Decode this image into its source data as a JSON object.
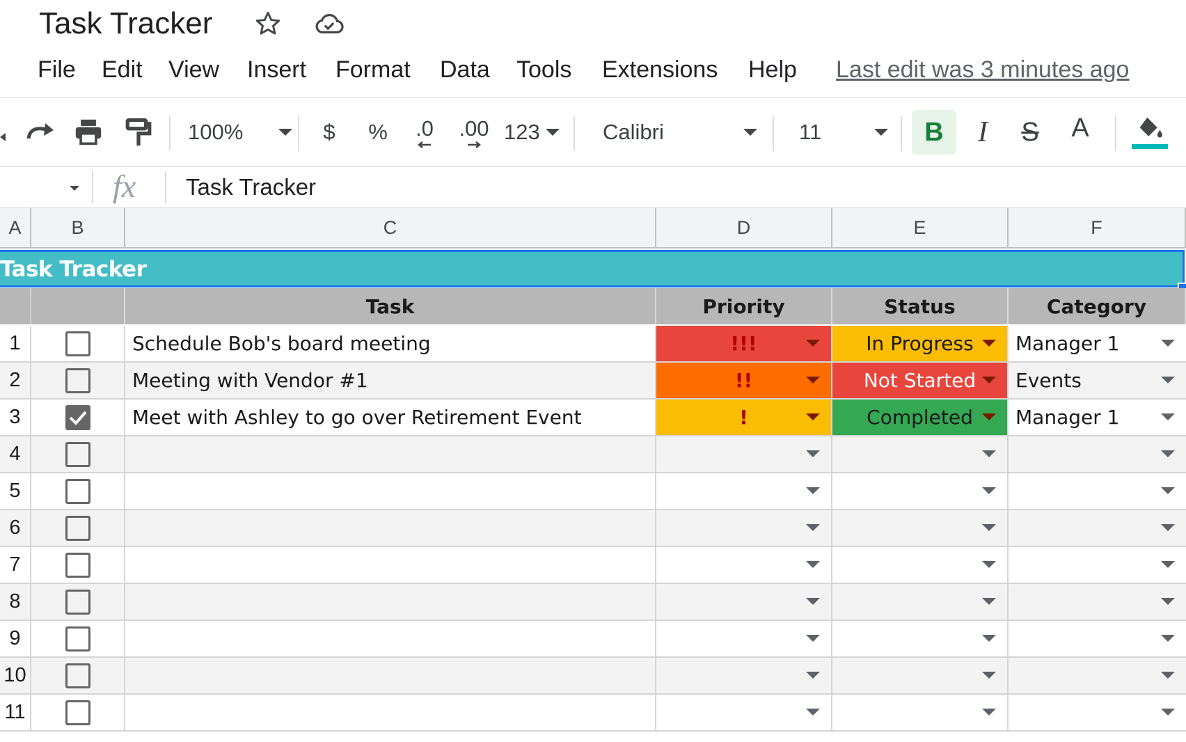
{
  "title": {
    "doc_name": "Task Tracker",
    "star_icon": "star-icon",
    "cloud_icon": "cloud-saved-icon"
  },
  "menu": {
    "items": [
      {
        "label": "File"
      },
      {
        "label": "Edit"
      },
      {
        "label": "View"
      },
      {
        "label": "Insert"
      },
      {
        "label": "Format"
      },
      {
        "label": "Data"
      },
      {
        "label": "Tools"
      },
      {
        "label": "Extensions"
      },
      {
        "label": "Help"
      }
    ],
    "last_edit": "Last edit was 3 minutes ago"
  },
  "toolbar": {
    "zoom": "100%",
    "currency": "$",
    "percent": "%",
    "decrease_decimal": ".0",
    "increase_decimal": ".00",
    "more_formats": "123",
    "font": "Calibri",
    "font_size": "11",
    "bold": "B",
    "italic": "I",
    "strikethrough": "S",
    "text_color": "A",
    "fill_color": "#00b8b8"
  },
  "formula_bar": {
    "fx": "fx",
    "content": "Task Tracker"
  },
  "columns": [
    "A",
    "B",
    "C",
    "D",
    "E",
    "F"
  ],
  "sheet": {
    "banner": "Task Tracker",
    "headers": {
      "task": "Task",
      "priority": "Priority",
      "status": "Status",
      "category": "Category"
    },
    "rows": [
      {
        "num": "1",
        "checked": false,
        "task": "Schedule Bob's board meeting",
        "priority": "!!!",
        "status": "In Progress",
        "category": "Manager 1"
      },
      {
        "num": "2",
        "checked": false,
        "task": "Meeting with Vendor #1",
        "priority": "!!",
        "status": "Not Started",
        "category": "Events"
      },
      {
        "num": "3",
        "checked": true,
        "task": "Meet with Ashley to go over Retirement Event",
        "priority": "!",
        "status": "Completed",
        "category": "Manager 1"
      },
      {
        "num": "4",
        "checked": false,
        "task": "",
        "priority": "",
        "status": "",
        "category": ""
      },
      {
        "num": "5",
        "checked": false,
        "task": "",
        "priority": "",
        "status": "",
        "category": ""
      },
      {
        "num": "6",
        "checked": false,
        "task": "",
        "priority": "",
        "status": "",
        "category": ""
      },
      {
        "num": "7",
        "checked": false,
        "task": "",
        "priority": "",
        "status": "",
        "category": ""
      },
      {
        "num": "8",
        "checked": false,
        "task": "",
        "priority": "",
        "status": "",
        "category": ""
      },
      {
        "num": "9",
        "checked": false,
        "task": "",
        "priority": "",
        "status": "",
        "category": ""
      },
      {
        "num": "10",
        "checked": false,
        "task": "",
        "priority": "",
        "status": "",
        "category": ""
      },
      {
        "num": "11",
        "checked": false,
        "task": "",
        "priority": "",
        "status": "",
        "category": ""
      }
    ]
  },
  "colors": {
    "banner": "#45bdc6",
    "priority_high": "#e8453c",
    "priority_medium": "#ff6d01",
    "priority_low": "#fbbc04",
    "status_in_progress": "#fbbc04",
    "status_not_started": "#e8453c",
    "status_completed": "#34a853"
  }
}
